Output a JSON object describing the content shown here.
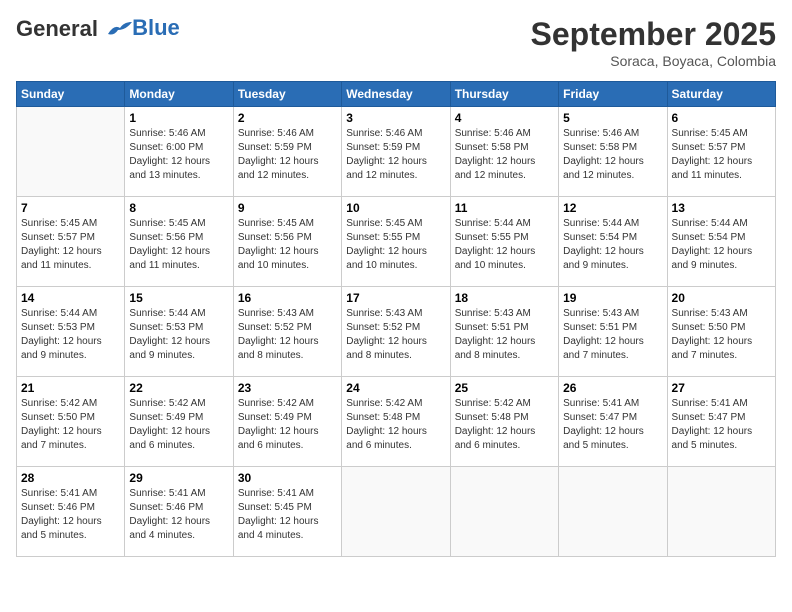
{
  "header": {
    "logo_line1": "General",
    "logo_line2": "Blue",
    "month_year": "September 2025",
    "location": "Soraca, Boyaca, Colombia"
  },
  "weekdays": [
    "Sunday",
    "Monday",
    "Tuesday",
    "Wednesday",
    "Thursday",
    "Friday",
    "Saturday"
  ],
  "weeks": [
    [
      {
        "day": "",
        "info": ""
      },
      {
        "day": "1",
        "info": "Sunrise: 5:46 AM\nSunset: 6:00 PM\nDaylight: 12 hours\nand 13 minutes."
      },
      {
        "day": "2",
        "info": "Sunrise: 5:46 AM\nSunset: 5:59 PM\nDaylight: 12 hours\nand 12 minutes."
      },
      {
        "day": "3",
        "info": "Sunrise: 5:46 AM\nSunset: 5:59 PM\nDaylight: 12 hours\nand 12 minutes."
      },
      {
        "day": "4",
        "info": "Sunrise: 5:46 AM\nSunset: 5:58 PM\nDaylight: 12 hours\nand 12 minutes."
      },
      {
        "day": "5",
        "info": "Sunrise: 5:46 AM\nSunset: 5:58 PM\nDaylight: 12 hours\nand 12 minutes."
      },
      {
        "day": "6",
        "info": "Sunrise: 5:45 AM\nSunset: 5:57 PM\nDaylight: 12 hours\nand 11 minutes."
      }
    ],
    [
      {
        "day": "7",
        "info": "Sunrise: 5:45 AM\nSunset: 5:57 PM\nDaylight: 12 hours\nand 11 minutes."
      },
      {
        "day": "8",
        "info": "Sunrise: 5:45 AM\nSunset: 5:56 PM\nDaylight: 12 hours\nand 11 minutes."
      },
      {
        "day": "9",
        "info": "Sunrise: 5:45 AM\nSunset: 5:56 PM\nDaylight: 12 hours\nand 10 minutes."
      },
      {
        "day": "10",
        "info": "Sunrise: 5:45 AM\nSunset: 5:55 PM\nDaylight: 12 hours\nand 10 minutes."
      },
      {
        "day": "11",
        "info": "Sunrise: 5:44 AM\nSunset: 5:55 PM\nDaylight: 12 hours\nand 10 minutes."
      },
      {
        "day": "12",
        "info": "Sunrise: 5:44 AM\nSunset: 5:54 PM\nDaylight: 12 hours\nand 9 minutes."
      },
      {
        "day": "13",
        "info": "Sunrise: 5:44 AM\nSunset: 5:54 PM\nDaylight: 12 hours\nand 9 minutes."
      }
    ],
    [
      {
        "day": "14",
        "info": "Sunrise: 5:44 AM\nSunset: 5:53 PM\nDaylight: 12 hours\nand 9 minutes."
      },
      {
        "day": "15",
        "info": "Sunrise: 5:44 AM\nSunset: 5:53 PM\nDaylight: 12 hours\nand 9 minutes."
      },
      {
        "day": "16",
        "info": "Sunrise: 5:43 AM\nSunset: 5:52 PM\nDaylight: 12 hours\nand 8 minutes."
      },
      {
        "day": "17",
        "info": "Sunrise: 5:43 AM\nSunset: 5:52 PM\nDaylight: 12 hours\nand 8 minutes."
      },
      {
        "day": "18",
        "info": "Sunrise: 5:43 AM\nSunset: 5:51 PM\nDaylight: 12 hours\nand 8 minutes."
      },
      {
        "day": "19",
        "info": "Sunrise: 5:43 AM\nSunset: 5:51 PM\nDaylight: 12 hours\nand 7 minutes."
      },
      {
        "day": "20",
        "info": "Sunrise: 5:43 AM\nSunset: 5:50 PM\nDaylight: 12 hours\nand 7 minutes."
      }
    ],
    [
      {
        "day": "21",
        "info": "Sunrise: 5:42 AM\nSunset: 5:50 PM\nDaylight: 12 hours\nand 7 minutes."
      },
      {
        "day": "22",
        "info": "Sunrise: 5:42 AM\nSunset: 5:49 PM\nDaylight: 12 hours\nand 6 minutes."
      },
      {
        "day": "23",
        "info": "Sunrise: 5:42 AM\nSunset: 5:49 PM\nDaylight: 12 hours\nand 6 minutes."
      },
      {
        "day": "24",
        "info": "Sunrise: 5:42 AM\nSunset: 5:48 PM\nDaylight: 12 hours\nand 6 minutes."
      },
      {
        "day": "25",
        "info": "Sunrise: 5:42 AM\nSunset: 5:48 PM\nDaylight: 12 hours\nand 6 minutes."
      },
      {
        "day": "26",
        "info": "Sunrise: 5:41 AM\nSunset: 5:47 PM\nDaylight: 12 hours\nand 5 minutes."
      },
      {
        "day": "27",
        "info": "Sunrise: 5:41 AM\nSunset: 5:47 PM\nDaylight: 12 hours\nand 5 minutes."
      }
    ],
    [
      {
        "day": "28",
        "info": "Sunrise: 5:41 AM\nSunset: 5:46 PM\nDaylight: 12 hours\nand 5 minutes."
      },
      {
        "day": "29",
        "info": "Sunrise: 5:41 AM\nSunset: 5:46 PM\nDaylight: 12 hours\nand 4 minutes."
      },
      {
        "day": "30",
        "info": "Sunrise: 5:41 AM\nSunset: 5:45 PM\nDaylight: 12 hours\nand 4 minutes."
      },
      {
        "day": "",
        "info": ""
      },
      {
        "day": "",
        "info": ""
      },
      {
        "day": "",
        "info": ""
      },
      {
        "day": "",
        "info": ""
      }
    ]
  ]
}
